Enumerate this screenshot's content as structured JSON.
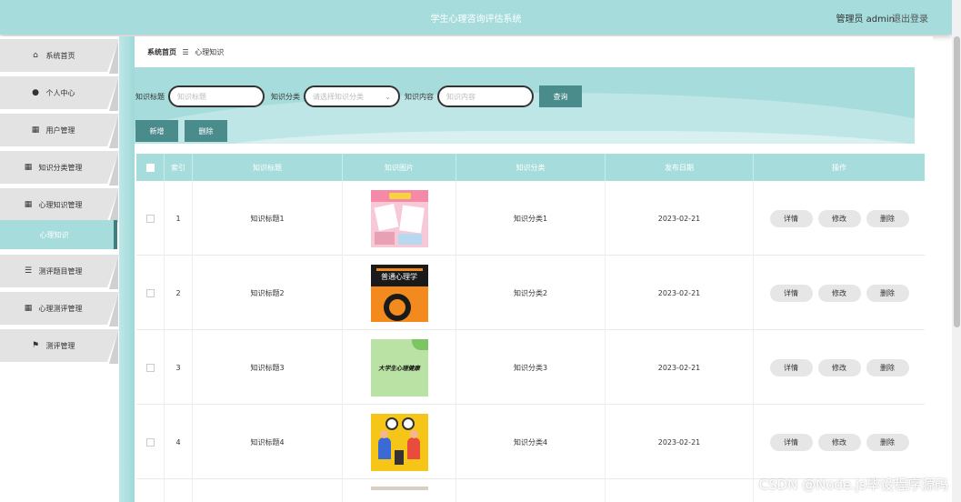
{
  "header": {
    "title": "学生心理咨询评估系统",
    "user": "管理员 admin",
    "logout": "退出登录"
  },
  "sidebar": {
    "items": [
      {
        "label": "系统首页",
        "icon": "home-icon"
      },
      {
        "label": "个人中心",
        "icon": "user-icon"
      },
      {
        "label": "用户管理",
        "icon": "grid-icon"
      },
      {
        "label": "知识分类管理",
        "icon": "grid-icon"
      },
      {
        "label": "心理知识管理",
        "icon": "grid-icon"
      },
      {
        "label": "测评题目管理",
        "icon": "list-icon"
      },
      {
        "label": "心理测评管理",
        "icon": "grid-icon"
      },
      {
        "label": "测评管理",
        "icon": "flag-icon"
      }
    ],
    "active_sub": "心理知识"
  },
  "breadcrumb": {
    "home": "系统首页",
    "sep": "☰",
    "current": "心理知识"
  },
  "search": {
    "title_label": "知识标题",
    "title_placeholder": "知识标题",
    "category_label": "知识分类",
    "category_placeholder": "请选择知识分类",
    "content_label": "知识内容",
    "content_placeholder": "知识内容",
    "query_button": "查询"
  },
  "actions": {
    "add": "新增",
    "delete": "删除"
  },
  "table": {
    "headers": [
      "索引",
      "知识标题",
      "知识图片",
      "知识分类",
      "发布日期",
      "操作"
    ],
    "rows": [
      {
        "index": "1",
        "title": "知识标题1",
        "category": "知识分类1",
        "date": "2023-02-21"
      },
      {
        "index": "2",
        "title": "知识标题2",
        "category": "知识分类2",
        "date": "2023-02-21",
        "image_text": "普通心理学"
      },
      {
        "index": "3",
        "title": "知识标题3",
        "category": "知识分类3",
        "date": "2023-02-21",
        "image_text": "大学生心理健康"
      },
      {
        "index": "4",
        "title": "知识标题4",
        "category": "知识分类4",
        "date": "2023-02-21"
      }
    ],
    "ops": {
      "detail": "详情",
      "edit": "修改",
      "delete": "删除"
    }
  },
  "watermark": "CSDN @Node.js毕设程序源码"
}
